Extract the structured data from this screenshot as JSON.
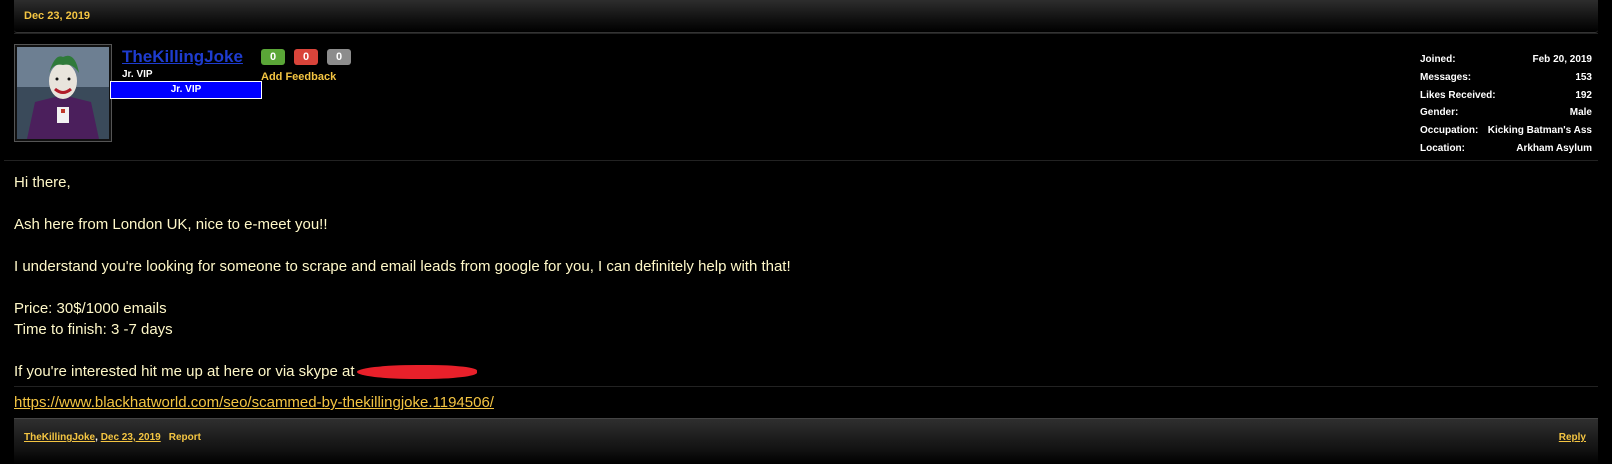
{
  "post": {
    "header_date": "Dec 23, 2019"
  },
  "author": {
    "username": "TheKillingJoke",
    "title": "Jr. VIP",
    "rank_banner": "Jr. VIP",
    "feedback": {
      "positive": "0",
      "negative": "0",
      "neutral": "0",
      "add_label": "Add Feedback"
    },
    "stats": [
      {
        "label": "Joined:",
        "value": "Feb 20, 2019"
      },
      {
        "label": "Messages:",
        "value": "153"
      },
      {
        "label": "Likes Received:",
        "value": "192"
      },
      {
        "label": "Gender:",
        "value": "Male"
      },
      {
        "label": "Occupation:",
        "value": "Kicking Batman's Ass"
      },
      {
        "label": "Location:",
        "value": "Arkham Asylum"
      }
    ]
  },
  "message": {
    "greeting": "Hi there,",
    "intro": "Ash here from London UK, nice to e-meet you!!",
    "pitch": "I understand you're looking for someone to scrape and email leads from google for you, I can definitely help with that!",
    "price": "Price: 30$/1000 emails",
    "time": "Time to finish: 3 -7 days",
    "contact": "If you're interested hit me up at here or via skype at"
  },
  "signature": {
    "link": "https://www.blackhatworld.com/seo/scammed-by-thekillingjoke.1194506/"
  },
  "footer": {
    "author": "TheKillingJoke",
    "date": "Dec 23, 2019",
    "report": "Report",
    "reply": "Reply"
  },
  "colors": {
    "accent": "#f4c542",
    "username": "#1e3ccf",
    "rank_banner": "#0000ff",
    "rep_positive": "#5aa637",
    "rep_negative": "#d9443a",
    "rep_neutral": "#8c8c8c",
    "redaction": "#e8202a"
  }
}
